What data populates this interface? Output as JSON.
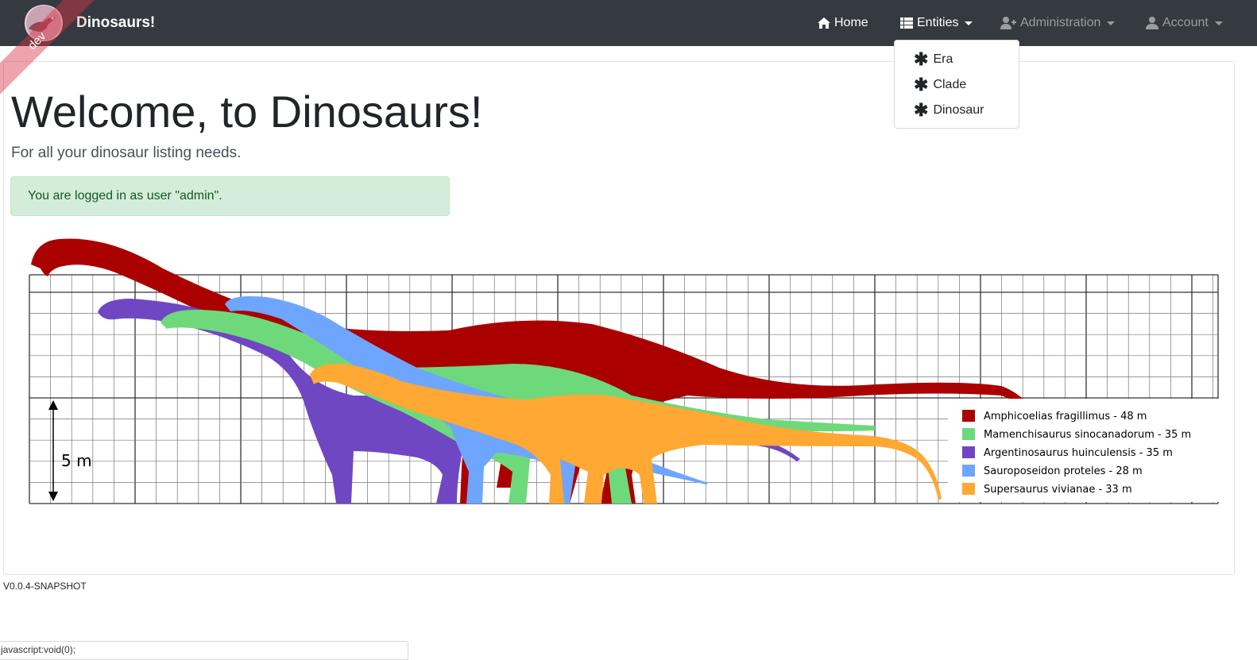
{
  "nav": {
    "brand_first": "D",
    "brand_rest": "inosaurs!",
    "ribbon": "dev",
    "home": "Home",
    "entities": "Entities",
    "administration": "Administration",
    "account": "Account",
    "entities_menu": [
      {
        "label": "Era",
        "icon": "asterisk-icon"
      },
      {
        "label": "Clade",
        "icon": "asterisk-icon"
      },
      {
        "label": "Dinosaur",
        "icon": "asterisk-icon"
      }
    ]
  },
  "main": {
    "title": "Welcome, to Dinosaurs!",
    "lead": "For all your dinosaur listing needs.",
    "alert": "You are logged in as user \"admin\".",
    "scale_label": "5 m",
    "legend": [
      {
        "name": "Amphicoelias fragillimus - 48 m",
        "color": "#aa0000"
      },
      {
        "name": "Mamenchisaurus sinocanadorum - 35 m",
        "color": "#6ed97a"
      },
      {
        "name": "Argentinosaurus huinculensis - 35 m",
        "color": "#7047c2"
      },
      {
        "name": "Sauroposeidon proteles - 28 m",
        "color": "#6ea6ff"
      },
      {
        "name": "Supersaurus vivianae - 33 m",
        "color": "#ffa833"
      }
    ]
  },
  "footer": {
    "version": "V0.0.4-SNAPSHOT",
    "status": "javascript:void(0);"
  },
  "colors": {
    "navbar": "#343a40",
    "alert_bg": "#d4edda",
    "alert_text": "#155724"
  }
}
